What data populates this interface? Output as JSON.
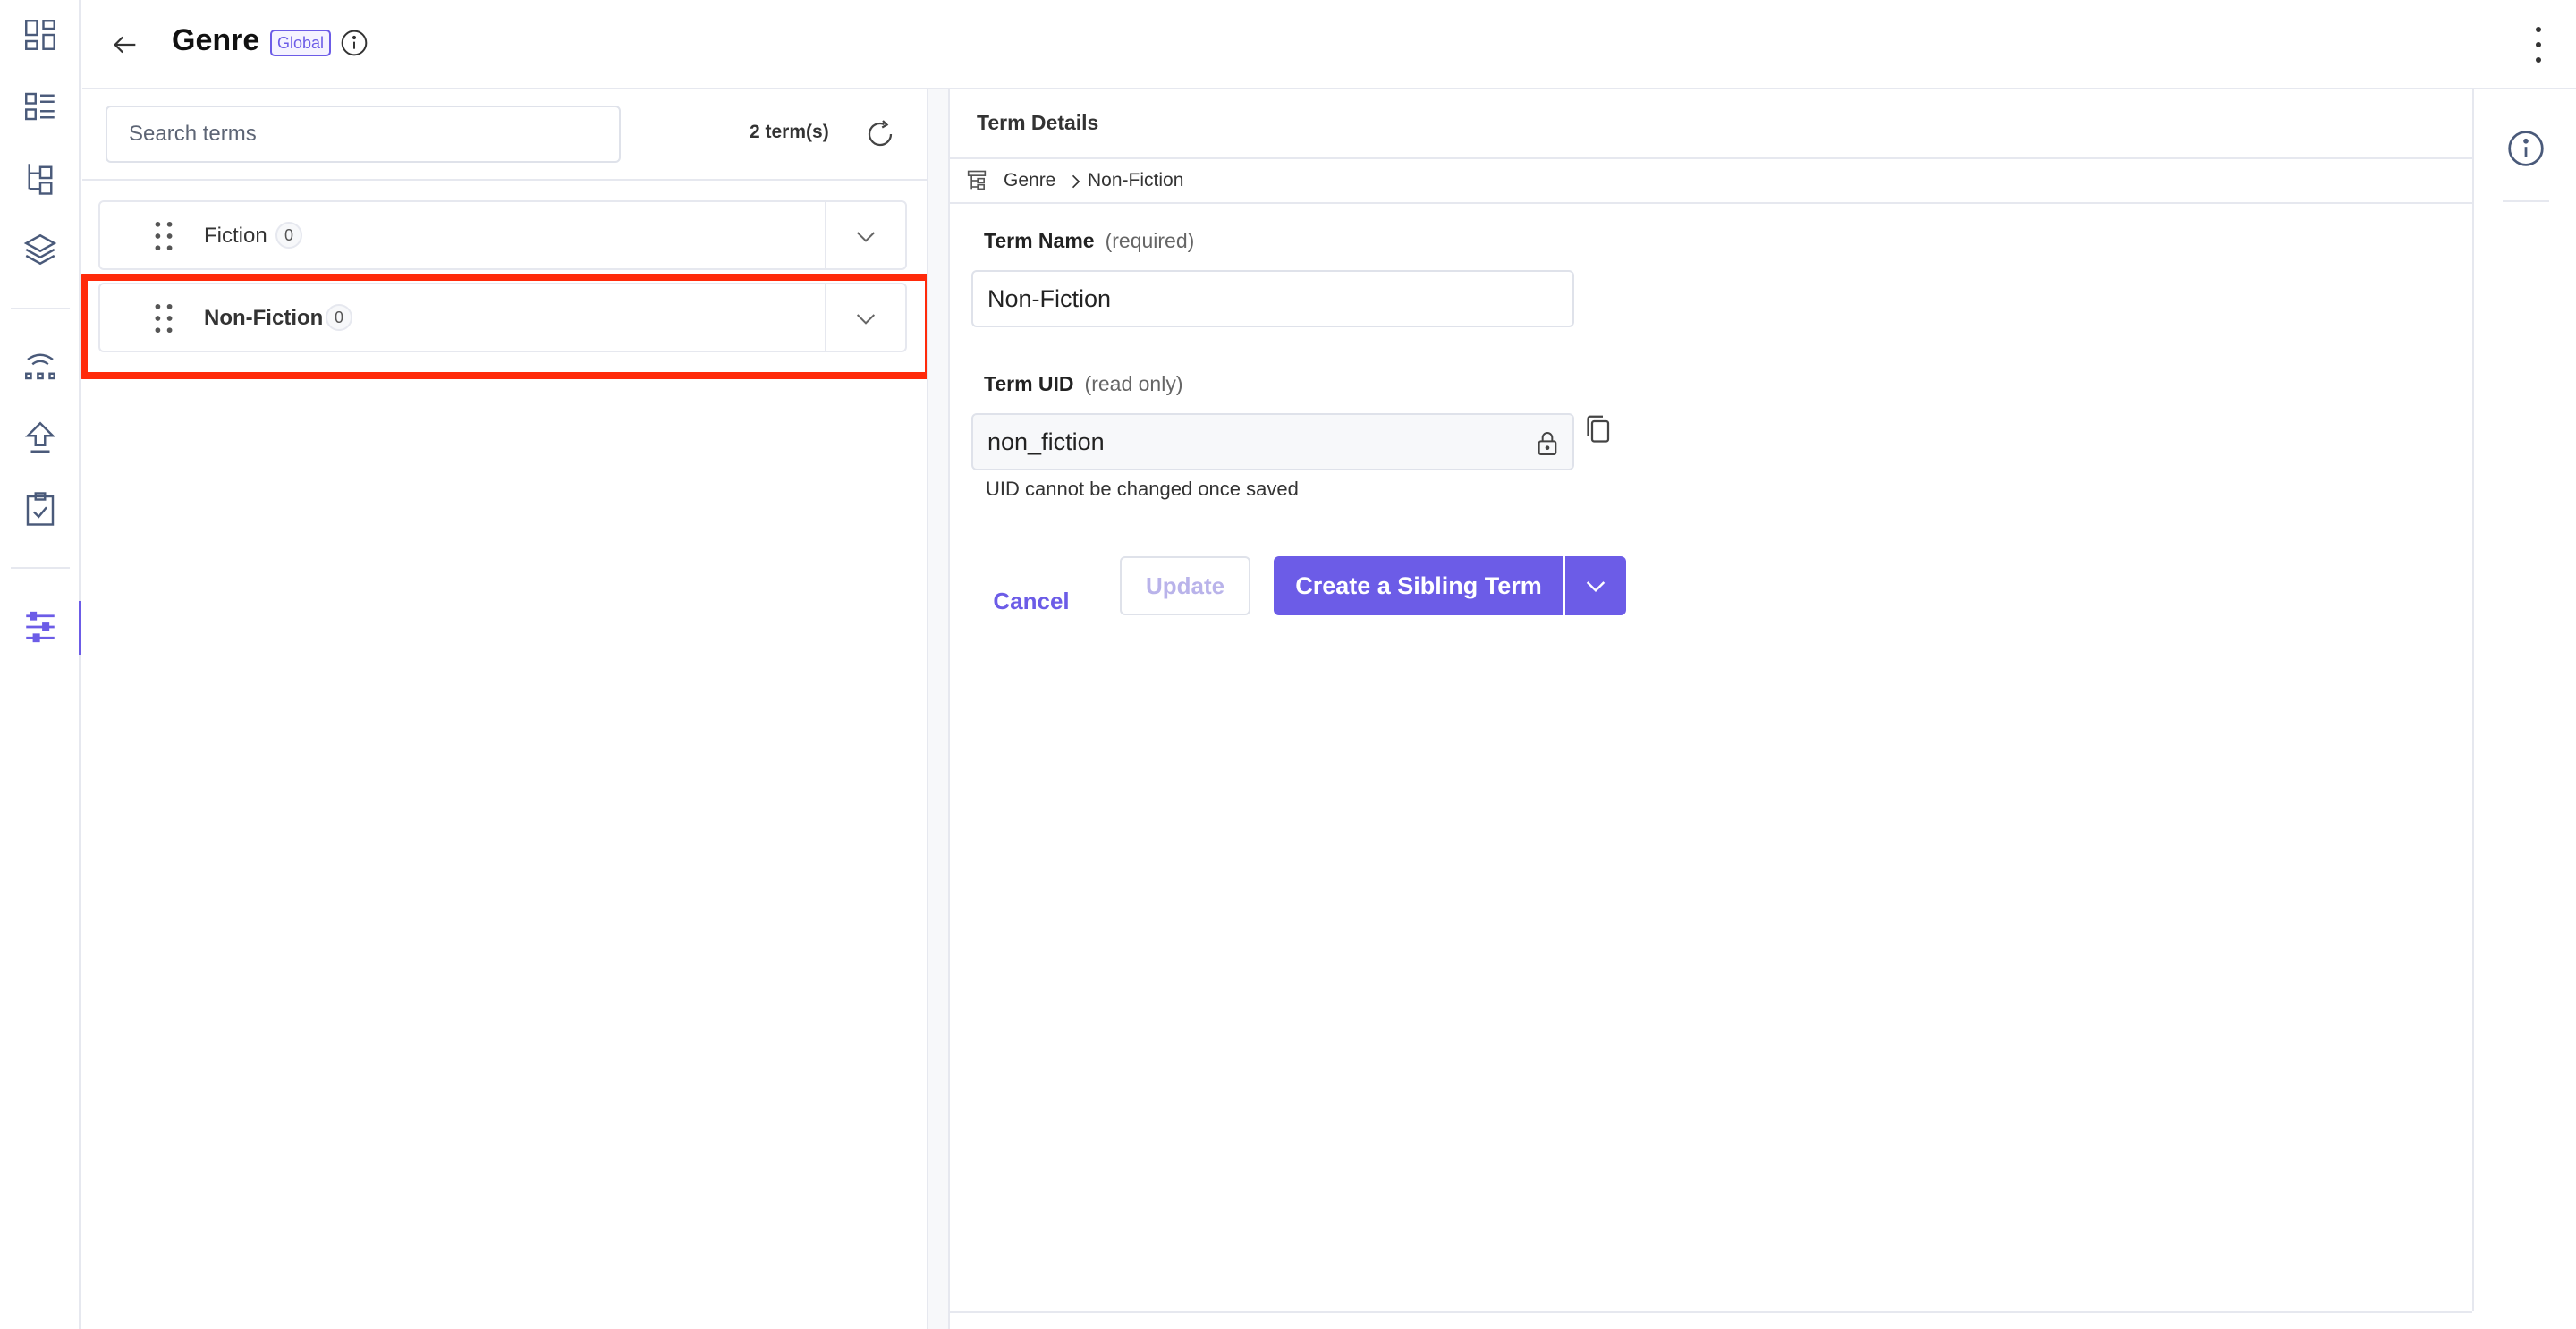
{
  "header": {
    "title": "Genre",
    "badge": "Global"
  },
  "terms_list": {
    "search_placeholder": "Search terms",
    "count_label": "2 term(s)",
    "items": [
      {
        "name": "Fiction",
        "count": "0"
      },
      {
        "name": "Non-Fiction",
        "count": "0",
        "selected": true
      }
    ]
  },
  "details": {
    "title": "Term Details",
    "breadcrumb": [
      "Genre",
      "Non-Fiction"
    ],
    "term_name_label": "Term Name",
    "term_name_hint": "(required)",
    "term_name_value": "Non-Fiction",
    "term_uid_label": "Term UID",
    "term_uid_hint": "(read only)",
    "term_uid_value": "non_fiction",
    "uid_help": "UID cannot be changed once saved",
    "cancel_label": "Cancel",
    "update_label": "Update",
    "create_sibling_label": "Create a Sibling Term"
  },
  "icons": {
    "rail": [
      "dashboard-icon",
      "entries-icon",
      "taxonomy-tree-icon",
      "stack-icon",
      "connection-icon",
      "publish-icon",
      "clipboard-check-icon",
      "settings-sliders-icon"
    ],
    "accent": "#6c5ce7",
    "rail_color": "#4a5a7a",
    "highlight": "#ff2a0a"
  }
}
